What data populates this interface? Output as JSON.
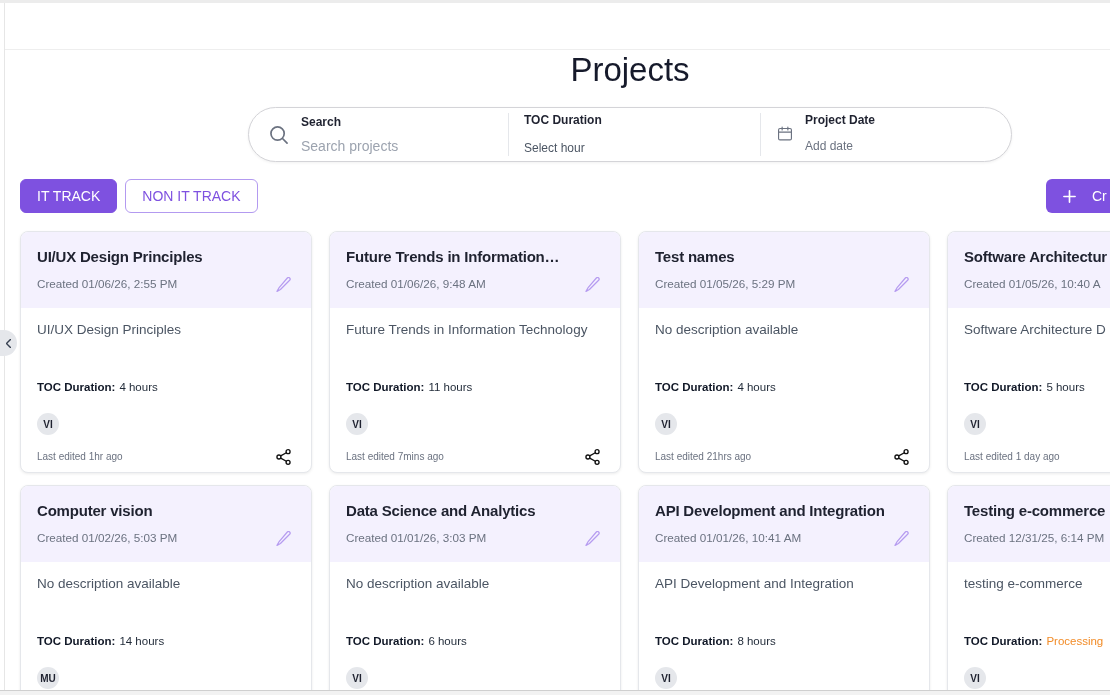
{
  "header": {
    "title": "Projects"
  },
  "search_bar": {
    "search": {
      "label": "Search",
      "placeholder": "Search projects"
    },
    "toc_duration": {
      "label": "TOC Duration",
      "placeholder": "Select hour"
    },
    "project_date": {
      "label": "Project Date",
      "placeholder": "Add date"
    }
  },
  "tabs": [
    {
      "label": "IT TRACK",
      "selected": true
    },
    {
      "label": "NON IT TRACK",
      "selected": false
    }
  ],
  "create_button": {
    "label": "Cr"
  },
  "projects": [
    {
      "title": "UI/UX Design Principles",
      "created": "Created 01/06/26, 2:55 PM",
      "description": "UI/UX Design Principles",
      "toc": {
        "label": "TOC Duration:",
        "value": "4 hours",
        "kind": "duration"
      },
      "avatar": "VI",
      "last_edited": "Last edited 1hr ago"
    },
    {
      "title": "Future Trends in Information…",
      "created": "Created 01/06/26, 9:48 AM",
      "description": "Future Trends in Information Technology",
      "toc": {
        "label": "TOC Duration:",
        "value": "11 hours",
        "kind": "duration"
      },
      "avatar": "VI",
      "last_edited": "Last edited 7mins ago"
    },
    {
      "title": "Test names",
      "created": "Created 01/05/26, 5:29 PM",
      "description": "No description available",
      "toc": {
        "label": "TOC Duration:",
        "value": "4 hours",
        "kind": "duration"
      },
      "avatar": "VI",
      "last_edited": "Last edited 21hrs ago"
    },
    {
      "title": "Software Architectur",
      "created": "Created 01/05/26, 10:40 A",
      "description": "Software Architecture D",
      "toc": {
        "label": "TOC Duration:",
        "value": "5 hours",
        "kind": "duration"
      },
      "avatar": "VI",
      "last_edited": "Last edited 1 day ago"
    },
    {
      "title": "Computer vision",
      "created": "Created 01/02/26, 5:03 PM",
      "description": "No description available",
      "toc": {
        "label": "TOC Duration:",
        "value": "14 hours",
        "kind": "duration"
      },
      "avatar": "MU"
    },
    {
      "title": "Data Science and Analytics",
      "created": "Created 01/01/26, 3:03 PM",
      "description": "No description available",
      "toc": {
        "label": "TOC Duration:",
        "value": "6 hours",
        "kind": "duration"
      },
      "avatar": "VI"
    },
    {
      "title": "API Development and Integration",
      "created": "Created 01/01/26, 10:41 AM",
      "description": "API Development and Integration",
      "toc": {
        "label": "TOC Duration:",
        "value": "8 hours",
        "kind": "duration"
      },
      "avatar": "VI"
    },
    {
      "title": "Testing e-commerce",
      "created": "Created 12/31/25, 6:14 PM",
      "description": "testing e-commerce",
      "toc": {
        "label": "TOC Duration:",
        "value": "Processing",
        "kind": "processing"
      },
      "avatar": "VI"
    }
  ]
}
